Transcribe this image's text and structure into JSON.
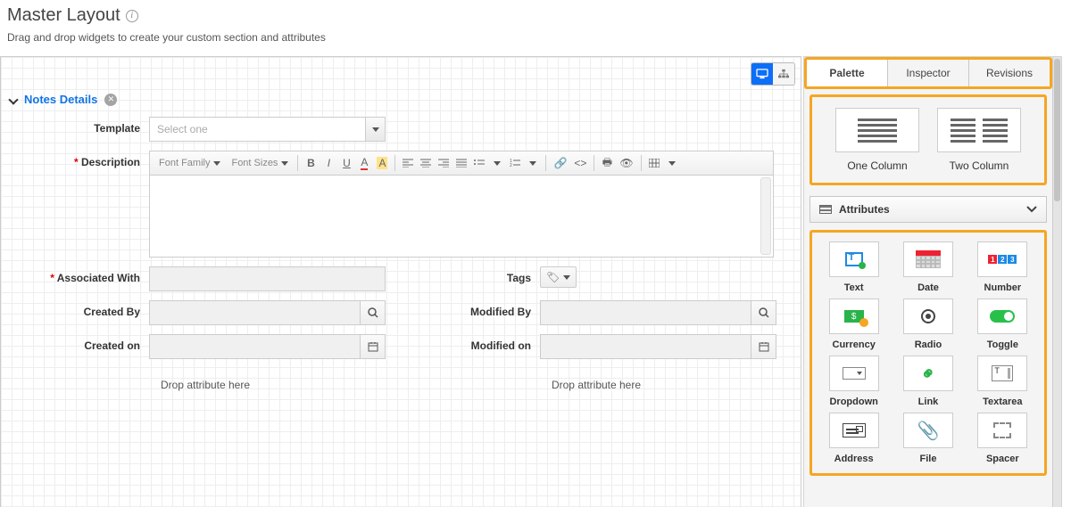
{
  "header": {
    "title": "Master Layout",
    "subtitle": "Drag and drop widgets to create your custom section and attributes"
  },
  "section": {
    "title": "Notes Details"
  },
  "form": {
    "template_label": "Template",
    "template_placeholder": "Select one",
    "description_label": "Description",
    "font_family": "Font Family",
    "font_sizes": "Font Sizes",
    "assoc_label": "Associated With",
    "tags_label": "Tags",
    "created_by_label": "Created By",
    "modified_by_label": "Modified By",
    "created_on_label": "Created on",
    "modified_on_label": "Modified on",
    "drop_hint": "Drop attribute here"
  },
  "tabs": {
    "palette": "Palette",
    "inspector": "Inspector",
    "revisions": "Revisions"
  },
  "layouts": {
    "one": "One Column",
    "two": "Two Column"
  },
  "attributes_label": "Attributes",
  "attrs": {
    "text": "Text",
    "date": "Date",
    "number": "Number",
    "currency": "Currency",
    "radio": "Radio",
    "toggle": "Toggle",
    "dropdown": "Dropdown",
    "link": "Link",
    "textarea": "Textarea",
    "address": "Address",
    "file": "File",
    "spacer": "Spacer"
  }
}
